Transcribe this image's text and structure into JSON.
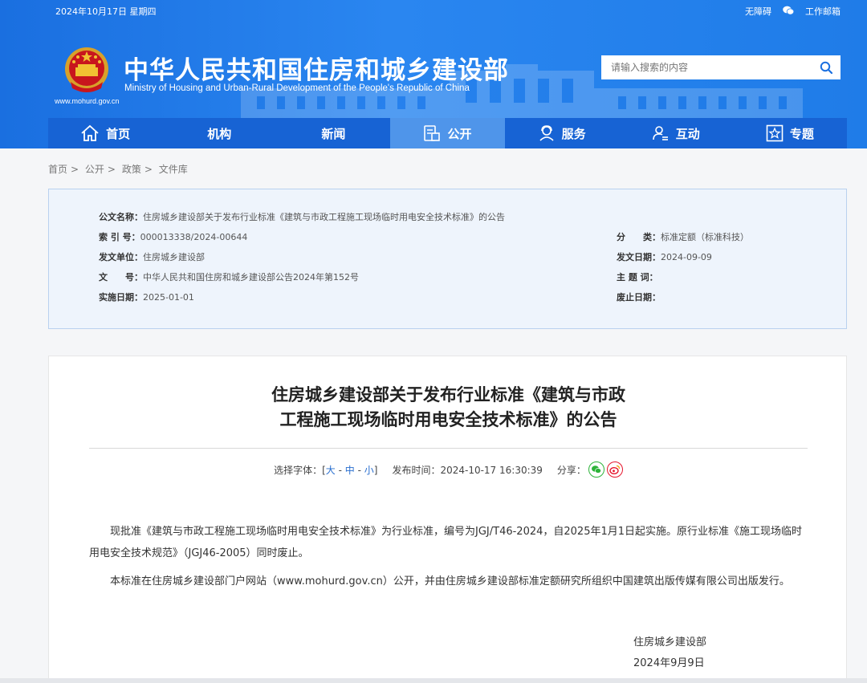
{
  "topbar": {
    "date": "2024年10月17日 星期四",
    "accessibility": "无障碍",
    "mailbox": "工作邮箱"
  },
  "site": {
    "title_cn": "中华人民共和国住房和城乡建设部",
    "title_en": "Ministry of Housing and Urban-Rural Development of the People's Republic of China",
    "url": "www.mohurd.gov.cn"
  },
  "search": {
    "placeholder": "请输入搜索的内容"
  },
  "nav": {
    "items": [
      {
        "label": "首页",
        "icon": "home-icon"
      },
      {
        "label": "机构",
        "icon": ""
      },
      {
        "label": "新闻",
        "icon": ""
      },
      {
        "label": "公开",
        "icon": "document-icon"
      },
      {
        "label": "服务",
        "icon": "service-icon"
      },
      {
        "label": "互动",
        "icon": "user-interact-icon"
      },
      {
        "label": "专题",
        "icon": "star-icon"
      }
    ]
  },
  "breadcrumb": [
    "首页",
    "公开",
    "政策",
    "文件库"
  ],
  "meta": {
    "title_label": "公文名称：",
    "title_value": "住房城乡建设部关于发布行业标准《建筑与市政工程施工现场临时用电安全技术标准》的公告",
    "index_label": "索 引 号：",
    "index_value": "000013338/2024-00644",
    "category_label": "分　　类：",
    "category_value": "标准定额（标准科技）",
    "issuer_label": "发文单位：",
    "issuer_value": "住房城乡建设部",
    "issue_date_label": "发文日期：",
    "issue_date_value": "2024-09-09",
    "doc_no_label": "文　　号：",
    "doc_no_value": "中华人民共和国住房和城乡建设部公告2024年第152号",
    "subject_label": "主 题 词：",
    "subject_value": "",
    "effective_label": "实施日期：",
    "effective_value": "2025-01-01",
    "repeal_label": "废止日期：",
    "repeal_value": ""
  },
  "article": {
    "title_line1": "住房城乡建设部关于发布行业标准《建筑与市政",
    "title_line2": "工程施工现场临时用电安全技术标准》的公告",
    "font_label": "选择字体：[",
    "font_large": "大",
    "font_medium": "中",
    "font_small": "小",
    "font_close": "]",
    "publish_label": "发布时间：",
    "publish_time": "2024-10-17 16:30:39",
    "share_label": "分享：",
    "paragraph1": "现批准《建筑与市政工程施工现场临时用电安全技术标准》为行业标准，编号为JGJ/T46-2024，自2025年1月1日起实施。原行业标准《施工现场临时用电安全技术规范》（JGJ46-2005）同时废止。",
    "paragraph2": "本标准在住房城乡建设部门户网站（www.mohurd.gov.cn）公开，并由住房城乡建设部标准定额研究所组织中国建筑出版传媒有限公司出版发行。",
    "signature": "住房城乡建设部",
    "sign_date": "2024年9月9日"
  },
  "colors": {
    "header_blue": "#2a86f0",
    "nav_blue": "#1763d4",
    "nav_active": "#4f95ea",
    "link_blue": "#2a6fcf",
    "wechat_green": "#2db33a",
    "weibo_red": "#e6162d"
  }
}
